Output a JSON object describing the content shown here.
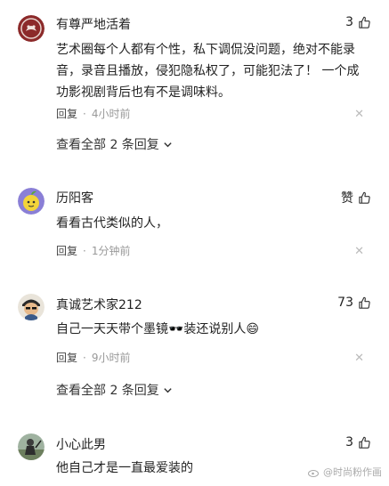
{
  "comments": [
    {
      "author": "有尊严地活着",
      "likes": "3",
      "text": "艺术圈每个人都有个性，私下调侃没问题，绝对不能录音，录音且播放，侵犯隐私权了，可能犯法了！ 一个成功影视剧背后也有不是调味料。",
      "reply_label": "回复",
      "time": "4小时前",
      "view_all": "查看全部 2 条回复"
    },
    {
      "author": "历阳客",
      "likes": "赞",
      "text": "看看古代类似的人，",
      "reply_label": "回复",
      "time": "1分钟前"
    },
    {
      "author": "真诚艺术家212",
      "likes": "73",
      "text": "自己一天天带个墨镜🕶️装还说别人😄",
      "reply_label": "回复",
      "time": "9小时前",
      "view_all": "查看全部 2 条回复"
    },
    {
      "author": "小心此男",
      "likes": "3",
      "text": "他自己才是一直最爱装的"
    }
  ],
  "dot": "·",
  "close_glyph": "✕",
  "watermark": "@时尚粉作画"
}
